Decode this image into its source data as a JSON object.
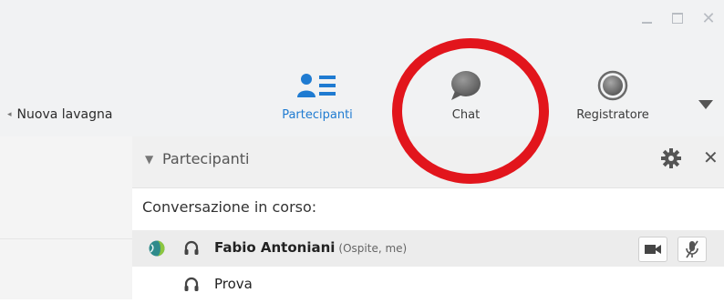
{
  "toolbar": {
    "new_whiteboard_label": "Nuova lavagna",
    "participants_label": "Partecipanti",
    "chat_label": "Chat",
    "recorder_label": "Registratore"
  },
  "panel": {
    "title": "Partecipanti",
    "conversation_label": "Conversazione in corso:"
  },
  "participants": [
    {
      "name": "Fabio Antoniani",
      "role": "(Ospite, me)"
    },
    {
      "name": "Prova",
      "role": ""
    }
  ],
  "colors": {
    "accent": "#1f7bd1",
    "highlight_ring": "#e2151c"
  }
}
